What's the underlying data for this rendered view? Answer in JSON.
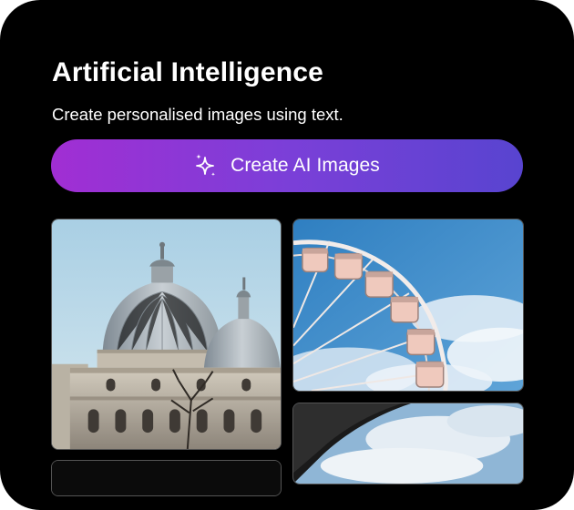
{
  "section": {
    "title": "Artificial Intelligence",
    "subtitle": "Create personalised images using text."
  },
  "cta": {
    "label": "Create AI Images",
    "icon": "sparkles-icon"
  },
  "gallery": {
    "images": [
      "palace-dome-photo",
      "ferris-wheel-photo",
      "sky-clouds-photo",
      "dark-photo"
    ]
  },
  "colors": {
    "background": "#000000",
    "text": "#ffffff",
    "gradient_start": "#a12ed3",
    "gradient_end": "#5844d0"
  }
}
